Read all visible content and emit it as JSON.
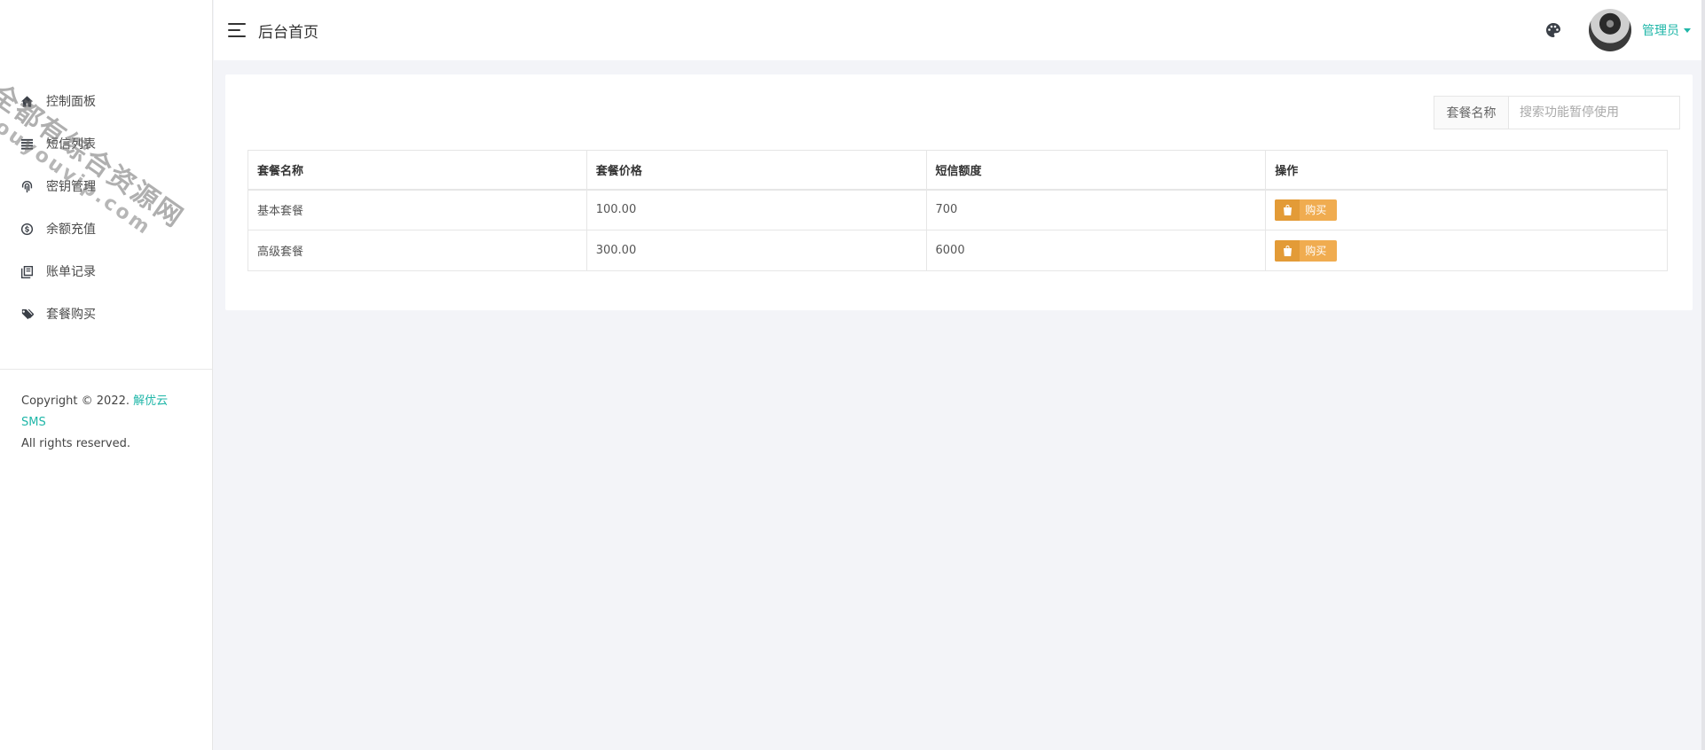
{
  "header": {
    "title": "后台首页",
    "user_name": "管理员"
  },
  "sidebar": {
    "items": [
      {
        "label": "控制面板",
        "icon": "home-icon"
      },
      {
        "label": "短信列表",
        "icon": "list-icon"
      },
      {
        "label": "密钥管理",
        "icon": "fingerprint-icon"
      },
      {
        "label": "余额充值",
        "icon": "dollar-circle-icon"
      },
      {
        "label": "账单记录",
        "icon": "book-icon"
      },
      {
        "label": "套餐购买",
        "icon": "tags-icon"
      }
    ],
    "copyright_prefix": "Copyright © 2022.",
    "brand": "解优云SMS",
    "rights": "All rights reserved."
  },
  "watermark": {
    "line1": "全都有综合资源网",
    "line2": "douyouvip.com"
  },
  "search": {
    "label": "套餐名称",
    "placeholder": "搜索功能暂停使用"
  },
  "table": {
    "headers": [
      "套餐名称",
      "套餐价格",
      "短信额度",
      "操作"
    ],
    "rows": [
      {
        "name": "基本套餐",
        "price": "100.00",
        "quota": "700",
        "action": "购买"
      },
      {
        "name": "高级套餐",
        "price": "300.00",
        "quota": "6000",
        "action": "购买"
      }
    ]
  },
  "colors": {
    "accent": "#1fb6a8",
    "buy_button": "#f0ac50",
    "background": "#f3f4f8"
  }
}
